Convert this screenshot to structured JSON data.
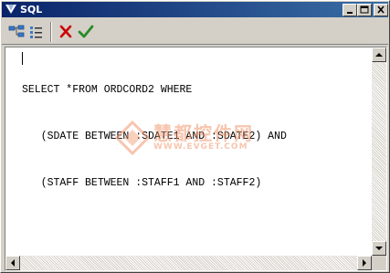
{
  "window": {
    "title": "SQL"
  },
  "toolbar": {
    "buttons": [
      {
        "icon": "tree-icon"
      },
      {
        "icon": "list-icon"
      },
      {
        "icon": "cancel-icon",
        "color": "#cc0000"
      },
      {
        "icon": "ok-icon",
        "color": "#2a8a2a"
      }
    ]
  },
  "editor": {
    "lines": [
      "SELECT *FROM ORDCORD2 WHERE",
      "   (SDATE BETWEEN :SDATE1 AND :SDATE2) AND",
      "   (STAFF BETWEEN :STAFF1 AND :STAFF2)"
    ]
  },
  "watermark": {
    "text": "慧都控件网",
    "url": "WWW.EVGET.COM",
    "color": "#f0966e"
  },
  "colors": {
    "titlebar_start": "#0a246a",
    "titlebar_end": "#3a6ea5",
    "face": "#d4d0c8"
  }
}
